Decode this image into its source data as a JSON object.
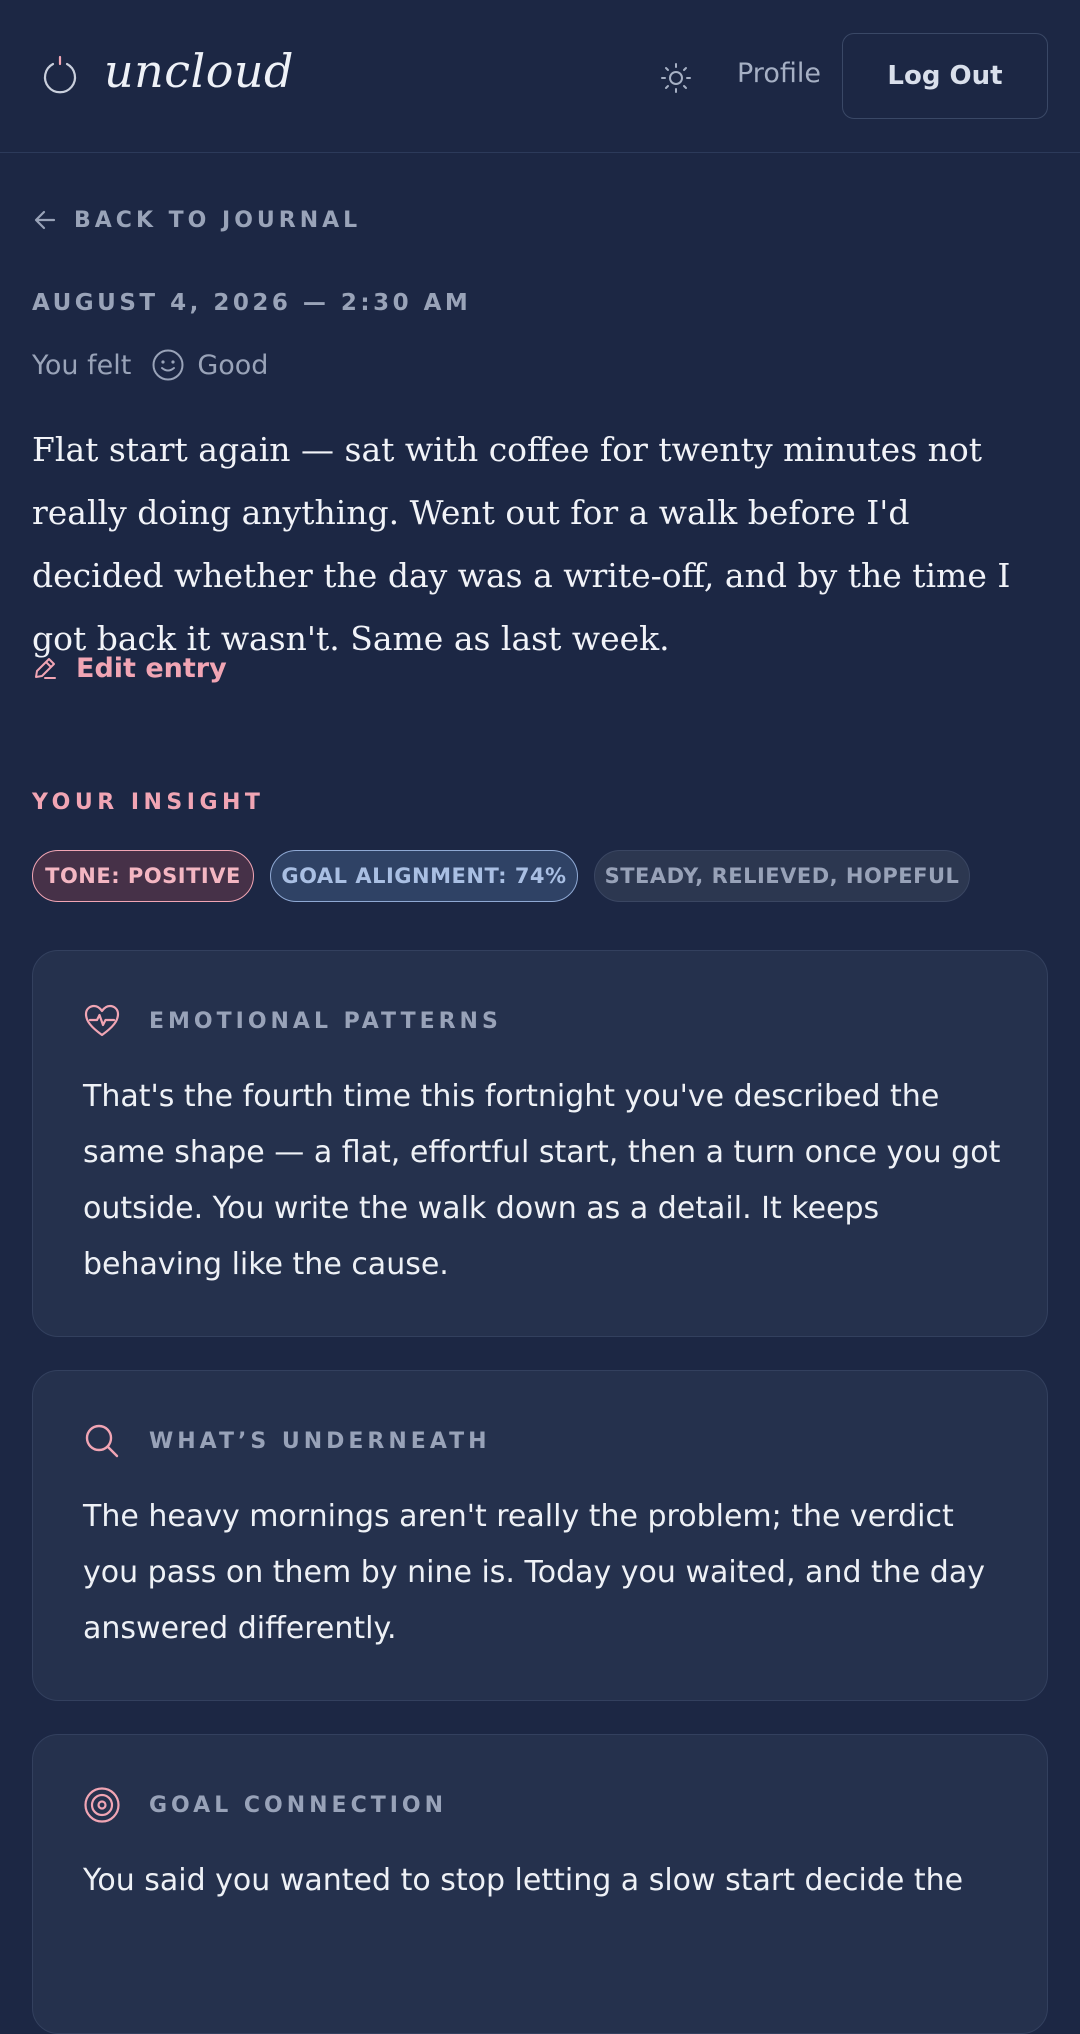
{
  "header": {
    "logo_text": "uncloud",
    "profile_label": "Profile",
    "logout_label": "Log Out"
  },
  "nav": {
    "back_label": "BACK TO JOURNAL"
  },
  "entry": {
    "date": "AUGUST 4, 2026 — 2:30 AM",
    "mood_prefix": "You felt",
    "mood": "Good",
    "text": "Flat start again — sat with coffee for twenty minutes not really doing anything. Went out for a walk before I'd decided whether the day was a write-off, and by the time I got back it wasn't. Same as last week.",
    "edit_label": "Edit entry"
  },
  "insight": {
    "heading": "YOUR INSIGHT",
    "pills": {
      "tone": "TONE: POSITIVE",
      "goal": "GOAL ALIGNMENT: 74%",
      "emotions": "STEADY, RELIEVED, HOPEFUL"
    },
    "cards": [
      {
        "title": "EMOTIONAL PATTERNS",
        "icon": "heart-pulse-icon",
        "body": "That's the fourth time this fortnight you've described the same shape — a flat, effortful start, then a turn once you got outside. You write the walk down as a detail. It keeps behaving like the cause."
      },
      {
        "title": "WHAT’S UNDERNEATH",
        "icon": "search-icon",
        "body": "The heavy mornings aren't really the problem; the verdict you pass on them by nine is. Today you waited, and the day answered differently."
      },
      {
        "title": "GOAL CONNECTION",
        "icon": "target-icon",
        "body": "You said you wanted to stop letting a slow start decide the"
      }
    ]
  },
  "colors": {
    "background": "#1c2744",
    "card": "#25314d",
    "accent_pink": "#f1a5b4",
    "accent_blue": "#8fa9d4",
    "muted_text": "#99a3b8"
  }
}
